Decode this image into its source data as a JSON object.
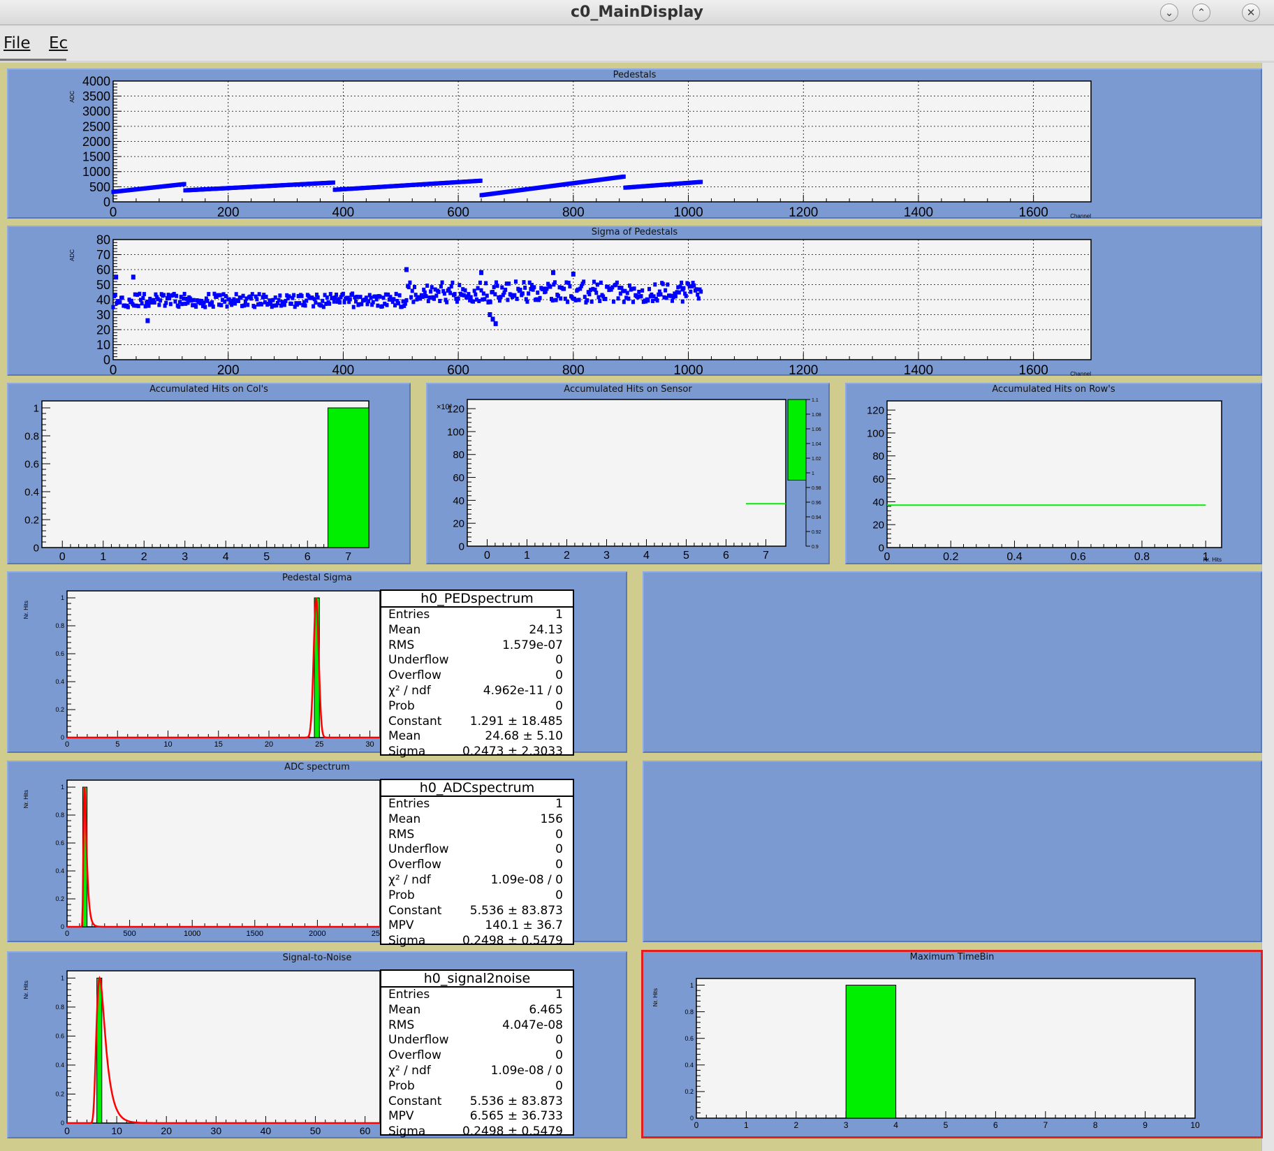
{
  "window": {
    "title": "c0_MainDisplay"
  },
  "menu": {
    "file": "File",
    "edit": "Ec"
  },
  "colors": {
    "pad": "#7c9ad2",
    "frame": "#d9d6a0",
    "blue": "#0000ff",
    "green": "#00ee00",
    "red": "#ff0000"
  },
  "icons": {
    "minimize": "chevron-down-icon",
    "maximize": "chevron-up-icon",
    "close": "close-icon"
  },
  "pads": {
    "pedestals": {
      "title": "Pedestals",
      "ylabel": "ADC",
      "xlabel": "Channel"
    },
    "sigma": {
      "title": "Sigma of Pedestals",
      "ylabel": "ADC",
      "xlabel": "Channel"
    },
    "cols": {
      "title": "Accumulated Hits on Col's",
      "ylabel": "Nr. Hits"
    },
    "sensor": {
      "title": "Accumulated Hits on Sensor",
      "exponent": "×10²"
    },
    "rows": {
      "title": "Accumulated Hits on Row's",
      "xlabel": "Nr. Hits"
    },
    "ped_sigma": {
      "title": "Pedestal Sigma",
      "ylabel": "Nr. Hits"
    },
    "adc": {
      "title": "ADC spectrum",
      "ylabel": "Nr. Hits"
    },
    "s2n": {
      "title": "Signal-to-Noise",
      "ylabel": "Nr. Hits"
    },
    "timebin": {
      "title": "Maximum TimeBin",
      "ylabel": "Nr. Hits"
    }
  },
  "stats": {
    "ped": {
      "name": "h0_PEDspectrum",
      "rows": [
        [
          "Entries",
          "1"
        ],
        [
          "Mean",
          "24.13"
        ],
        [
          "RMS",
          "1.579e-07"
        ],
        [
          "Underflow",
          "0"
        ],
        [
          "Overflow",
          "0"
        ],
        [
          "χ² / ndf",
          "4.962e-11 / 0"
        ],
        [
          "Prob",
          "0"
        ],
        [
          "Constant",
          "1.291 ± 18.485"
        ],
        [
          "Mean",
          "24.68 ± 5.10"
        ],
        [
          "Sigma",
          "0.2473 ± 2.3033"
        ]
      ]
    },
    "adc": {
      "name": "h0_ADCspectrum",
      "rows": [
        [
          "Entries",
          "1"
        ],
        [
          "Mean",
          "156"
        ],
        [
          "RMS",
          "0"
        ],
        [
          "Underflow",
          "0"
        ],
        [
          "Overflow",
          "0"
        ],
        [
          "χ² / ndf",
          "1.09e-08 / 0"
        ],
        [
          "Prob",
          "0"
        ],
        [
          "Constant",
          "5.536 ± 83.873"
        ],
        [
          "MPV",
          "140.1 ± 36.7"
        ],
        [
          "Sigma",
          "0.2498 ± 0.5479"
        ]
      ]
    },
    "s2n": {
      "name": "h0_signal2noise",
      "rows": [
        [
          "Entries",
          "1"
        ],
        [
          "Mean",
          "6.465"
        ],
        [
          "RMS",
          "4.047e-08"
        ],
        [
          "Underflow",
          "0"
        ],
        [
          "Overflow",
          "0"
        ],
        [
          "χ² / ndf",
          "1.09e-08 / 0"
        ],
        [
          "Prob",
          "0"
        ],
        [
          "Constant",
          "5.536 ± 83.873"
        ],
        [
          "MPV",
          "6.565 ± 36.733"
        ],
        [
          "Sigma",
          "0.2498 ± 0.5479"
        ]
      ]
    }
  },
  "chart_data": [
    {
      "id": "pedestals",
      "type": "scatter",
      "title": "Pedestals",
      "xlabel": "Channel",
      "ylabel": "ADC",
      "xlim": [
        0,
        1700
      ],
      "ylim": [
        0,
        4000
      ],
      "xticks": [
        0,
        200,
        400,
        600,
        800,
        1000,
        1200,
        1400,
        1600
      ],
      "yticks": [
        0,
        500,
        1000,
        1500,
        2000,
        2500,
        3000,
        3500,
        4000
      ],
      "grid": true,
      "segments": [
        {
          "x0": 0,
          "x1": 125,
          "y0": 330,
          "y1": 590
        },
        {
          "x0": 125,
          "x1": 385,
          "y0": 380,
          "y1": 640
        },
        {
          "x0": 385,
          "x1": 640,
          "y0": 400,
          "y1": 700
        },
        {
          "x0": 640,
          "x1": 890,
          "y0": 220,
          "y1": 840
        },
        {
          "x0": 890,
          "x1": 1023,
          "y0": 470,
          "y1": 660
        }
      ]
    },
    {
      "id": "sigma",
      "type": "scatter",
      "title": "Sigma of Pedestals",
      "xlabel": "Channel",
      "ylabel": "ADC",
      "xlim": [
        0,
        1700
      ],
      "ylim": [
        0,
        80
      ],
      "xticks": [
        0,
        200,
        400,
        600,
        800,
        1000,
        1200,
        1400,
        1600
      ],
      "yticks": [
        0,
        10,
        20,
        30,
        40,
        50,
        60,
        70,
        80
      ],
      "grid": true,
      "segments": [
        {
          "x0": 0,
          "x1": 510,
          "y0": 35,
          "y1": 44
        },
        {
          "x0": 510,
          "x1": 1023,
          "y0": 38,
          "y1": 52
        }
      ],
      "outliers": [
        [
          5,
          55
        ],
        [
          35,
          55
        ],
        [
          60,
          26
        ],
        [
          510,
          60
        ],
        [
          640,
          58
        ],
        [
          655,
          30
        ],
        [
          660,
          27
        ],
        [
          665,
          24
        ],
        [
          765,
          58
        ],
        [
          800,
          57
        ],
        [
          990,
          47
        ]
      ]
    },
    {
      "id": "cols",
      "type": "bar",
      "title": "Accumulated Hits on Col's",
      "ylabel": "Nr. Hits",
      "xlim": [
        -0.5,
        7.5
      ],
      "ylim": [
        0,
        1.05
      ],
      "xticks": [
        0,
        1,
        2,
        3,
        4,
        5,
        6,
        7
      ],
      "yticks": [
        0,
        0.2,
        0.4,
        0.6,
        0.8,
        1
      ],
      "bars": [
        {
          "x0": 6.5,
          "x1": 7.5,
          "value": 1
        }
      ]
    },
    {
      "id": "sensor",
      "type": "heatmap",
      "title": "Accumulated Hits on Sensor",
      "xlim": [
        -0.5,
        7.5
      ],
      "ylim": [
        0,
        128
      ],
      "xticks": [
        0,
        1,
        2,
        3,
        4,
        5,
        6,
        7
      ],
      "yticks": [
        0,
        20,
        40,
        60,
        80,
        100,
        120
      ],
      "zlim": [
        0.9,
        1.1
      ],
      "zticks": [
        0.9,
        0.92,
        0.94,
        0.96,
        0.98,
        1,
        1.02,
        1.04,
        1.06,
        1.08,
        1.1
      ],
      "line": {
        "x0": 6.5,
        "x1": 7.5,
        "y": 37
      }
    },
    {
      "id": "rows",
      "type": "line",
      "title": "Accumulated Hits on Row's",
      "xlabel": "Nr. Hits",
      "xlim": [
        0,
        1.05
      ],
      "ylim": [
        0,
        128
      ],
      "xticks": [
        0,
        0.2,
        0.4,
        0.6,
        0.8,
        1
      ],
      "yticks": [
        0,
        20,
        40,
        60,
        80,
        100,
        120
      ],
      "line": {
        "x0": 0,
        "x1": 1,
        "y": 37
      }
    },
    {
      "id": "ped_sigma",
      "type": "bar",
      "title": "Pedestal Sigma",
      "ylabel": "Nr. Hits",
      "xlim": [
        0,
        31
      ],
      "ylim": [
        0,
        1.05
      ],
      "xticks": [
        0,
        5,
        10,
        15,
        20,
        25,
        30
      ],
      "yticks": [
        0,
        0.2,
        0.4,
        0.6,
        0.8,
        1
      ],
      "bars": [
        {
          "x0": 24.5,
          "x1": 25,
          "value": 1
        }
      ],
      "fit": {
        "kind": "gaus",
        "mean": 24.68,
        "sigma": 0.2473,
        "amp": 1
      }
    },
    {
      "id": "adc",
      "type": "bar",
      "title": "ADC spectrum",
      "ylabel": "Nr. Hits",
      "xlim": [
        0,
        2500
      ],
      "ylim": [
        0,
        1.05
      ],
      "xticks": [
        0,
        500,
        1000,
        1500,
        2000,
        2500
      ],
      "yticks": [
        0,
        0.2,
        0.4,
        0.6,
        0.8,
        1
      ],
      "bars": [
        {
          "x0": 125,
          "x1": 160,
          "value": 1
        }
      ],
      "fit": {
        "kind": "landau",
        "mpv": 140.1,
        "sigma": 8,
        "amp": 1
      }
    },
    {
      "id": "s2n",
      "type": "bar",
      "title": "Signal-to-Noise",
      "ylabel": "Nr. Hits",
      "xlim": [
        0,
        63
      ],
      "ylim": [
        0,
        1.05
      ],
      "xticks": [
        0,
        10,
        20,
        30,
        40,
        50,
        60
      ],
      "yticks": [
        0,
        0.2,
        0.4,
        0.6,
        0.8,
        1
      ],
      "bars": [
        {
          "x0": 6,
          "x1": 7,
          "value": 1
        }
      ],
      "fit": {
        "kind": "landau",
        "mpv": 6.565,
        "sigma": 0.6,
        "amp": 1
      }
    },
    {
      "id": "timebin",
      "type": "bar",
      "title": "Maximum TimeBin",
      "ylabel": "Nr. Hits",
      "xlim": [
        0,
        10
      ],
      "ylim": [
        0,
        1.05
      ],
      "xticks": [
        0,
        1,
        2,
        3,
        4,
        5,
        6,
        7,
        8,
        9,
        10
      ],
      "yticks": [
        0,
        0.2,
        0.4,
        0.6,
        0.8,
        1
      ],
      "bars": [
        {
          "x0": 3,
          "x1": 4,
          "value": 1
        }
      ]
    }
  ]
}
